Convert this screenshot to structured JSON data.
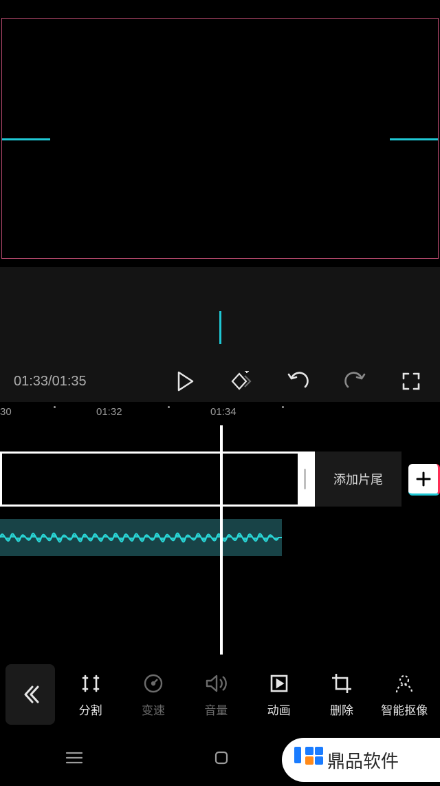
{
  "preview": {
    "accent": "#1fc7d4"
  },
  "controls": {
    "current_time": "01:33",
    "total_time": "01:35",
    "time_display": "01:33/01:35"
  },
  "ruler": {
    "marks": [
      "30",
      "01:32",
      "01:34"
    ]
  },
  "timeline": {
    "tail_label": "添加片尾",
    "add_label": "+"
  },
  "toolbar": {
    "items": [
      {
        "id": "split",
        "label": "分割",
        "enabled": true
      },
      {
        "id": "speed",
        "label": "变速",
        "enabled": false
      },
      {
        "id": "volume",
        "label": "音量",
        "enabled": false
      },
      {
        "id": "anim",
        "label": "动画",
        "enabled": true
      },
      {
        "id": "delete",
        "label": "删除",
        "enabled": true
      },
      {
        "id": "cutout",
        "label": "智能抠像",
        "enabled": true
      }
    ]
  },
  "watermark": {
    "text": "鼎品软件"
  }
}
